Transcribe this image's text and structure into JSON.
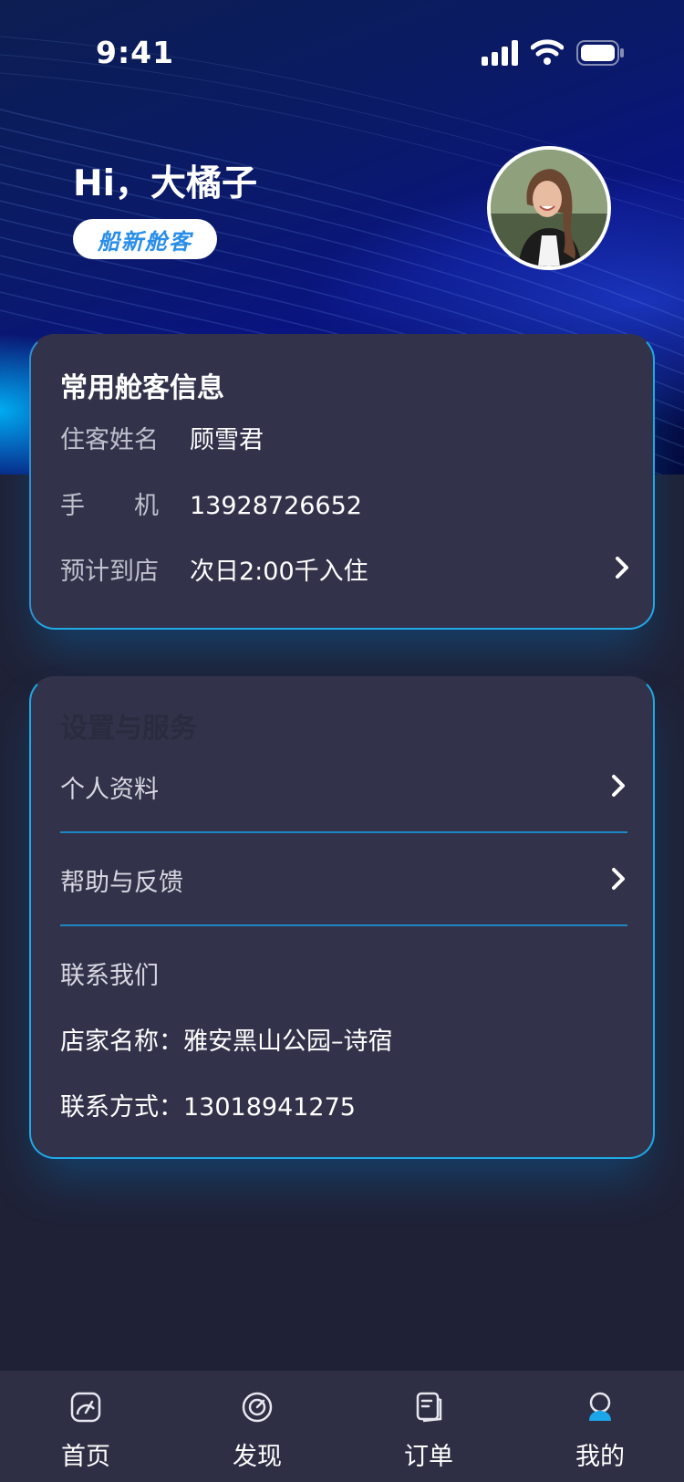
{
  "status_bar": {
    "time": "9:41"
  },
  "header": {
    "greeting": "Hi，大橘子",
    "badge": "船新舱客"
  },
  "guest_card": {
    "title": "常用舱客信息",
    "rows": [
      {
        "label": "住客姓名",
        "value": "顾雪君"
      },
      {
        "label": "手　　机",
        "value": "13928726652"
      },
      {
        "label": "预计到店",
        "value": "次日2:00千入住"
      }
    ]
  },
  "settings_card": {
    "title": "设置与服务",
    "menu": [
      {
        "label": "个人资料"
      },
      {
        "label": "帮助与反馈"
      }
    ],
    "contact_title": "联系我们",
    "shop_name": "店家名称：雅安黑山公园–诗宿",
    "contact_phone": "联系方式：13018941275"
  },
  "tabbar": {
    "items": [
      {
        "label": "首页",
        "icon": "home-gauge-icon"
      },
      {
        "label": "发现",
        "icon": "discover-icon"
      },
      {
        "label": "订单",
        "icon": "order-icon"
      },
      {
        "label": "我的",
        "icon": "profile-icon",
        "active": true
      }
    ],
    "active_color": "#1aa6e8"
  },
  "colors": {
    "card_bg": "#32334a",
    "card_border": "#1fa9e6",
    "page_bg": "#1f2237",
    "badge_text": "#2a8ee8"
  }
}
